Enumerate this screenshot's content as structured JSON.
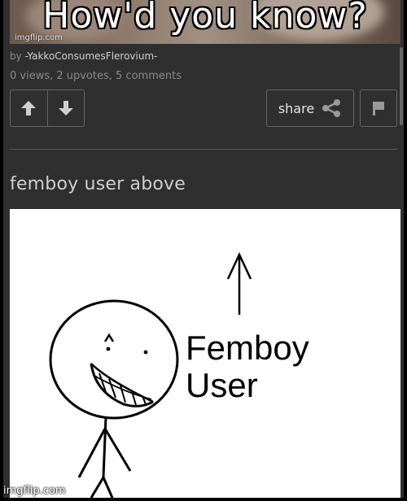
{
  "meme": {
    "caption": "How'd you know?",
    "watermark": "imgflip.com"
  },
  "post": {
    "by_prefix": "by",
    "author": "-YakkoConsumesFlerovium-",
    "stats": "0 views, 2 upvotes, 5 comments"
  },
  "actions": {
    "upvote_icon": "arrow-up-icon",
    "downvote_icon": "arrow-down-icon",
    "share_label": "share",
    "share_icon": "share-icon",
    "flag_icon": "flag-icon"
  },
  "comment": {
    "text": "femboy user above",
    "image_text_line1": "Femboy",
    "image_text_line2": "User"
  },
  "footer_watermark": "imgflip.com",
  "colors": {
    "panel_bg": "#2f2f30",
    "border": "#666666",
    "muted_text": "#8b8b8b"
  }
}
